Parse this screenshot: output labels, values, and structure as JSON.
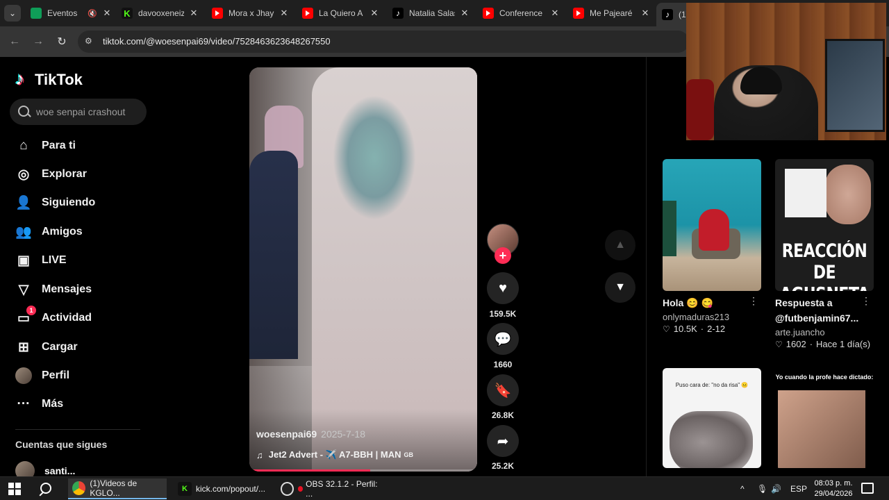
{
  "browser": {
    "tabs": [
      {
        "label": "Eventos",
        "icon": "sheets-icon",
        "muted": true
      },
      {
        "label": "davooxeneiz",
        "icon": "kick-icon"
      },
      {
        "label": "Mora x Jhay",
        "icon": "youtube-icon"
      },
      {
        "label": "La Quiero A",
        "icon": "youtube-icon"
      },
      {
        "label": "Natalia Salas",
        "icon": "tiktok-icon"
      },
      {
        "label": "Conference",
        "icon": "youtube-icon"
      },
      {
        "label": "Me Pajearé",
        "icon": "youtube-icon"
      },
      {
        "label": "(1)",
        "icon": "tiktok-icon",
        "active": true
      }
    ],
    "url": "tiktok.com/@woesenpai69/video/7528463623648267550"
  },
  "tiktok": {
    "logo": "TikTok",
    "search_placeholder": "woe senpai crashout",
    "nav": [
      {
        "label": "Para ti",
        "icon": "home-icon"
      },
      {
        "label": "Explorar",
        "icon": "compass-icon"
      },
      {
        "label": "Siguiendo",
        "icon": "following-icon"
      },
      {
        "label": "Amigos",
        "icon": "friends-icon"
      },
      {
        "label": "LIVE",
        "icon": "live-icon"
      },
      {
        "label": "Mensajes",
        "icon": "messages-icon"
      },
      {
        "label": "Actividad",
        "icon": "activity-icon",
        "badge": "1"
      },
      {
        "label": "Cargar",
        "icon": "upload-icon"
      },
      {
        "label": "Perfil",
        "icon": "profile-avatar"
      },
      {
        "label": "Más",
        "icon": "more-icon"
      }
    ],
    "following_title": "Cuentas que sigues",
    "following_user": "santi..."
  },
  "video": {
    "author": "woesenpai69",
    "date": "2025-7-18",
    "music": "Jet2 Advert - ✈️ A7-BBH | MAN",
    "music_suffix": "GB",
    "progress": 0.53,
    "likes": "159.5K",
    "comments": "1660",
    "saves": "26.8K",
    "shares": "25.2K"
  },
  "recommended": [
    {
      "title": "Hola 😊 😋",
      "user": "onlymaduras213",
      "likes": "10.5K",
      "age": "2-12"
    },
    {
      "title": "Respuesta a @futbenjamin67...",
      "user": "arte.juancho",
      "likes": "1602",
      "age": "Hace 1 día(s)",
      "thumb_text": "REACCIÓN DE AGUSNETA"
    },
    {
      "thumb_caption": "Puso cara de: \"no da risa\" 😐"
    },
    {
      "thumb_caption": "Yo cuando la profe hace dictado:"
    }
  ],
  "taskbar": {
    "apps": [
      {
        "label": "(1)Videos de KGLO...",
        "icon": "chrome-icon"
      },
      {
        "label": "kick.com/popout/...",
        "icon": "kick-icon"
      },
      {
        "label": "OBS 32.1.2 - Perfil: ...",
        "icon": "obs-icon"
      }
    ],
    "lang": "ESP",
    "time": "08:03 p. m.",
    "date": "29/04/2026"
  }
}
